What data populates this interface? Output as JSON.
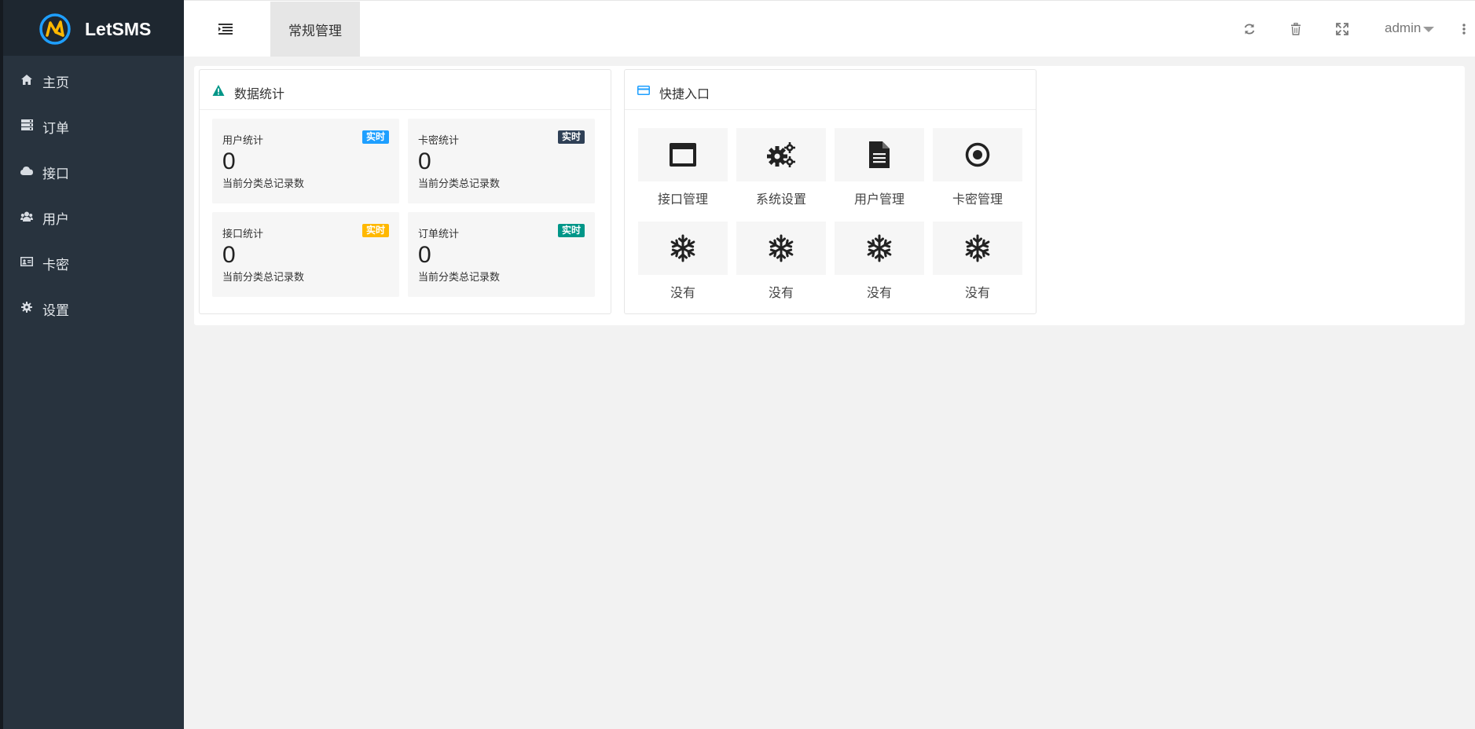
{
  "app": {
    "name": "LetSMS"
  },
  "sidebar": {
    "items": [
      {
        "icon": "home-icon",
        "label": "主页"
      },
      {
        "icon": "server-icon",
        "label": "订单"
      },
      {
        "icon": "cloud-icon",
        "label": "接口"
      },
      {
        "icon": "users-icon",
        "label": "用户"
      },
      {
        "icon": "id-card-icon",
        "label": "卡密"
      },
      {
        "icon": "gear-icon",
        "label": "设置"
      }
    ]
  },
  "header": {
    "active_tab": "常规管理",
    "user": "admin"
  },
  "stats_card": {
    "title": "数据统计",
    "items": [
      {
        "title": "用户统计",
        "badge": "实时",
        "badge_color": "#1e9fff",
        "value": "0",
        "desc": "当前分类总记录数"
      },
      {
        "title": "卡密统计",
        "badge": "实时",
        "badge_color": "#2f4056",
        "value": "0",
        "desc": "当前分类总记录数"
      },
      {
        "title": "接口统计",
        "badge": "实时",
        "badge_color": "#ffb800",
        "value": "0",
        "desc": "当前分类总记录数"
      },
      {
        "title": "订单统计",
        "badge": "实时",
        "badge_color": "#009688",
        "value": "0",
        "desc": "当前分类总记录数"
      }
    ]
  },
  "quick_card": {
    "title": "快捷入口",
    "items": [
      {
        "icon": "window-icon",
        "label": "接口管理"
      },
      {
        "icon": "gears-icon",
        "label": "系统设置"
      },
      {
        "icon": "document-icon",
        "label": "用户管理"
      },
      {
        "icon": "dot-circle-icon",
        "label": "卡密管理"
      },
      {
        "icon": "snowflake-icon",
        "label": "没有"
      },
      {
        "icon": "snowflake-icon",
        "label": "没有"
      },
      {
        "icon": "snowflake-icon",
        "label": "没有"
      },
      {
        "icon": "snowflake-icon",
        "label": "没有"
      }
    ]
  },
  "colors": {
    "sidebar_bg": "#28333e",
    "logo_bg": "#1e2730",
    "accent_teal": "#009688",
    "accent_blue": "#1e9fff"
  }
}
